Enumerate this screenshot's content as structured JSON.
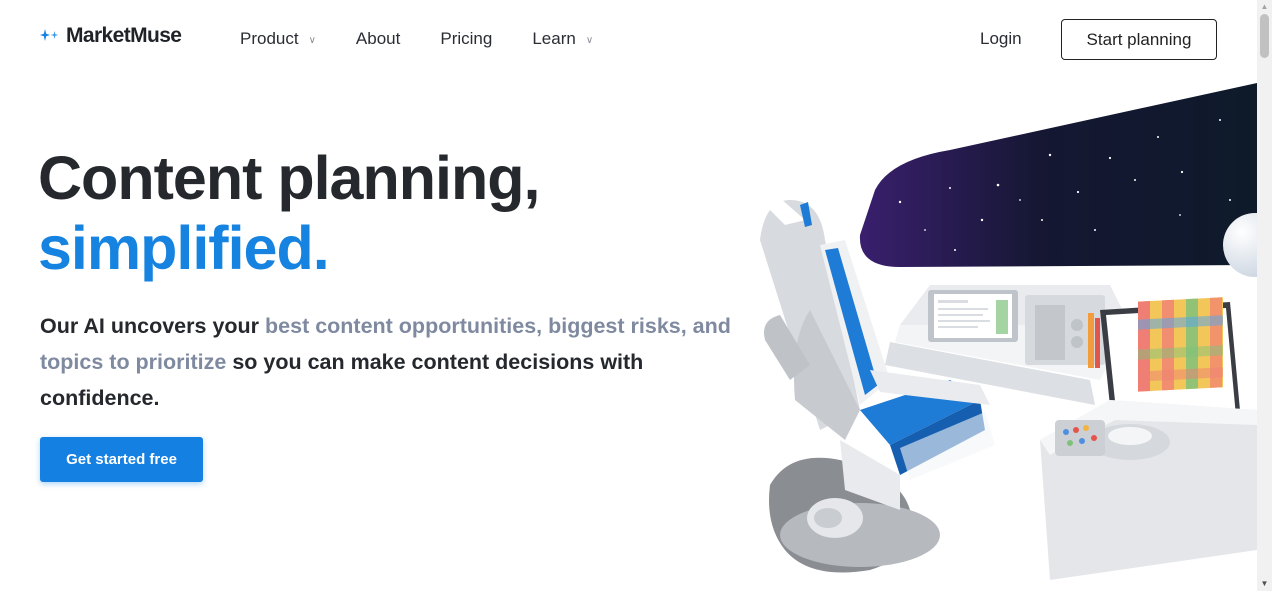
{
  "brand": {
    "name": "MarketMuse",
    "logo_icon": "sparkles-icon",
    "logo_color": "#1683e0"
  },
  "nav": {
    "items": [
      {
        "label": "Product",
        "has_dropdown": true
      },
      {
        "label": "About",
        "has_dropdown": false
      },
      {
        "label": "Pricing",
        "has_dropdown": false
      },
      {
        "label": "Learn",
        "has_dropdown": true
      }
    ],
    "login_label": "Login",
    "start_label": "Start planning"
  },
  "hero": {
    "headline_line1": "Content planning,",
    "headline_line2": "simplified.",
    "sub_part1": "Our AI uncovers your ",
    "sub_highlight": "best content opportunities, biggest risks, and topics to prioritize",
    "sub_part2": " so you can make content decisions with confidence.",
    "cta_label": "Get started free"
  },
  "colors": {
    "accent": "#1683e0",
    "button": "#1380e2",
    "muted": "#7f8aa0",
    "text": "#25282d"
  }
}
